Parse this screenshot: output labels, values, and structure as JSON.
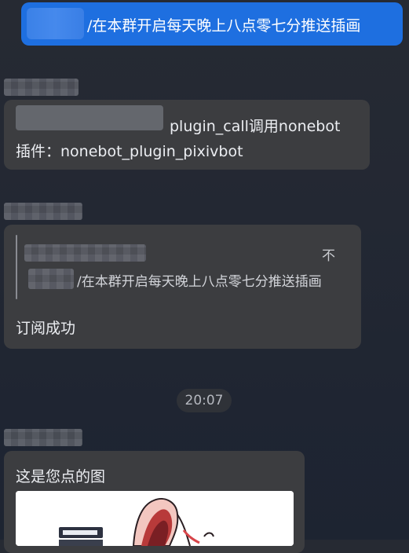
{
  "messages": {
    "self_command": {
      "text": "/在本群开启每天晚上八点零七分推送插画"
    },
    "bot_reply_1": {
      "line1": "plugin_call调用nonebot",
      "line2": "插件：nonebot_plugin_pixivbot"
    },
    "bot_reply_2": {
      "quote_text": "/在本群开启每天晚上八点零七分推送插画",
      "quote_action": "不",
      "text": "订阅成功"
    },
    "timestamp": "20:07",
    "bot_reply_3": {
      "text": "这是您点的图"
    }
  },
  "colors": {
    "self_bubble": "#1e6fe0",
    "bot_bubble": "#3c3d40",
    "background": "#232833"
  },
  "icons": {
    "image_thumbnail": "anime-illustration"
  }
}
